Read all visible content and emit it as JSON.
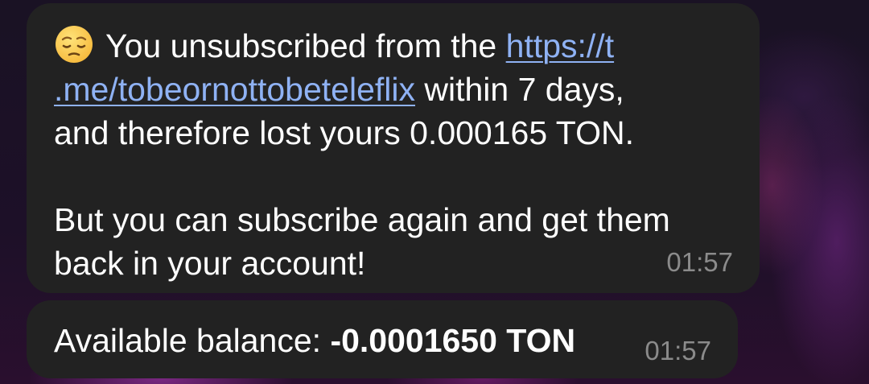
{
  "message_1": {
    "emoji": "pensive-face-icon",
    "text_before_link": "You unsubscribed from the ",
    "link_text_line1": "https://t",
    "link_text_line2": ".me/tobeornottobeteleflix",
    "text_after_link_line2": " within 7 days,",
    "text_line3": "and therefore lost yours 0.000165 TON.",
    "paragraph_2_line1": "But you can subscribe again and get them",
    "paragraph_2_line2": "back in your account!",
    "time": "01:57"
  },
  "message_2": {
    "label": "Available balance: ",
    "value": "-0.0001650 TON",
    "time": "01:57"
  },
  "colors": {
    "bubble_bg": "#222222",
    "link": "#8fb2f4",
    "timestamp": "#8b8b8b",
    "text": "#ffffff"
  }
}
